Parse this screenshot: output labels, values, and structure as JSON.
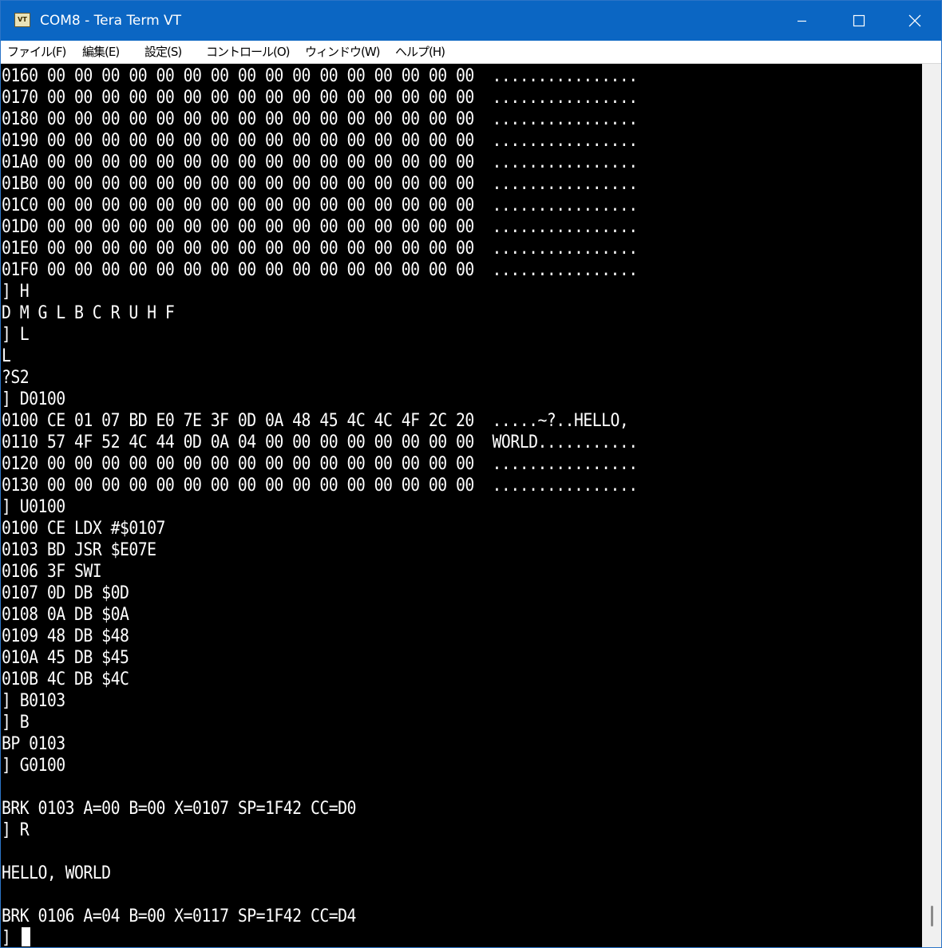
{
  "window": {
    "title": "COM8 - Tera Term VT",
    "icon_label": "VT",
    "icons": {
      "app": "teraterm-app-icon",
      "minimize": "minimize-icon",
      "maximize": "maximize-icon",
      "close": "close-icon"
    },
    "colors": {
      "titlebar": "#0b66c3",
      "terminal_bg": "#000000",
      "terminal_fg": "#ffffff"
    }
  },
  "menu": {
    "items": [
      {
        "label": "ファイル(F)"
      },
      {
        "label": "編集(E)"
      },
      {
        "label": "設定(S)"
      },
      {
        "label": "コントロール(O)"
      },
      {
        "label": "ウィンドウ(W)"
      },
      {
        "label": "ヘルプ(H)"
      }
    ]
  },
  "terminal": {
    "lines": [
      "0160 00 00 00 00 00 00 00 00 00 00 00 00 00 00 00 00  ................",
      "0170 00 00 00 00 00 00 00 00 00 00 00 00 00 00 00 00  ................",
      "0180 00 00 00 00 00 00 00 00 00 00 00 00 00 00 00 00  ................",
      "0190 00 00 00 00 00 00 00 00 00 00 00 00 00 00 00 00  ................",
      "01A0 00 00 00 00 00 00 00 00 00 00 00 00 00 00 00 00  ................",
      "01B0 00 00 00 00 00 00 00 00 00 00 00 00 00 00 00 00  ................",
      "01C0 00 00 00 00 00 00 00 00 00 00 00 00 00 00 00 00  ................",
      "01D0 00 00 00 00 00 00 00 00 00 00 00 00 00 00 00 00  ................",
      "01E0 00 00 00 00 00 00 00 00 00 00 00 00 00 00 00 00  ................",
      "01F0 00 00 00 00 00 00 00 00 00 00 00 00 00 00 00 00  ................",
      "] H",
      "D M G L B C R U H F",
      "] L",
      "L",
      "?S2",
      "] D0100",
      "0100 CE 01 07 BD E0 7E 3F 0D 0A 48 45 4C 4C 4F 2C 20  .....~?..HELLO,",
      "0110 57 4F 52 4C 44 0D 0A 04 00 00 00 00 00 00 00 00  WORLD...........",
      "0120 00 00 00 00 00 00 00 00 00 00 00 00 00 00 00 00  ................",
      "0130 00 00 00 00 00 00 00 00 00 00 00 00 00 00 00 00  ................",
      "] U0100",
      "0100 CE LDX #$0107",
      "0103 BD JSR $E07E",
      "0106 3F SWI",
      "0107 0D DB $0D",
      "0108 0A DB $0A",
      "0109 48 DB $48",
      "010A 45 DB $45",
      "010B 4C DB $4C",
      "] B0103",
      "] B",
      "BP 0103",
      "] G0100",
      "",
      "BRK 0103 A=00 B=00 X=0107 SP=1F42 CC=D0",
      "] R",
      "",
      "HELLO, WORLD",
      "",
      "BRK 0106 A=04 B=00 X=0117 SP=1F42 CC=D4",
      "]"
    ]
  }
}
